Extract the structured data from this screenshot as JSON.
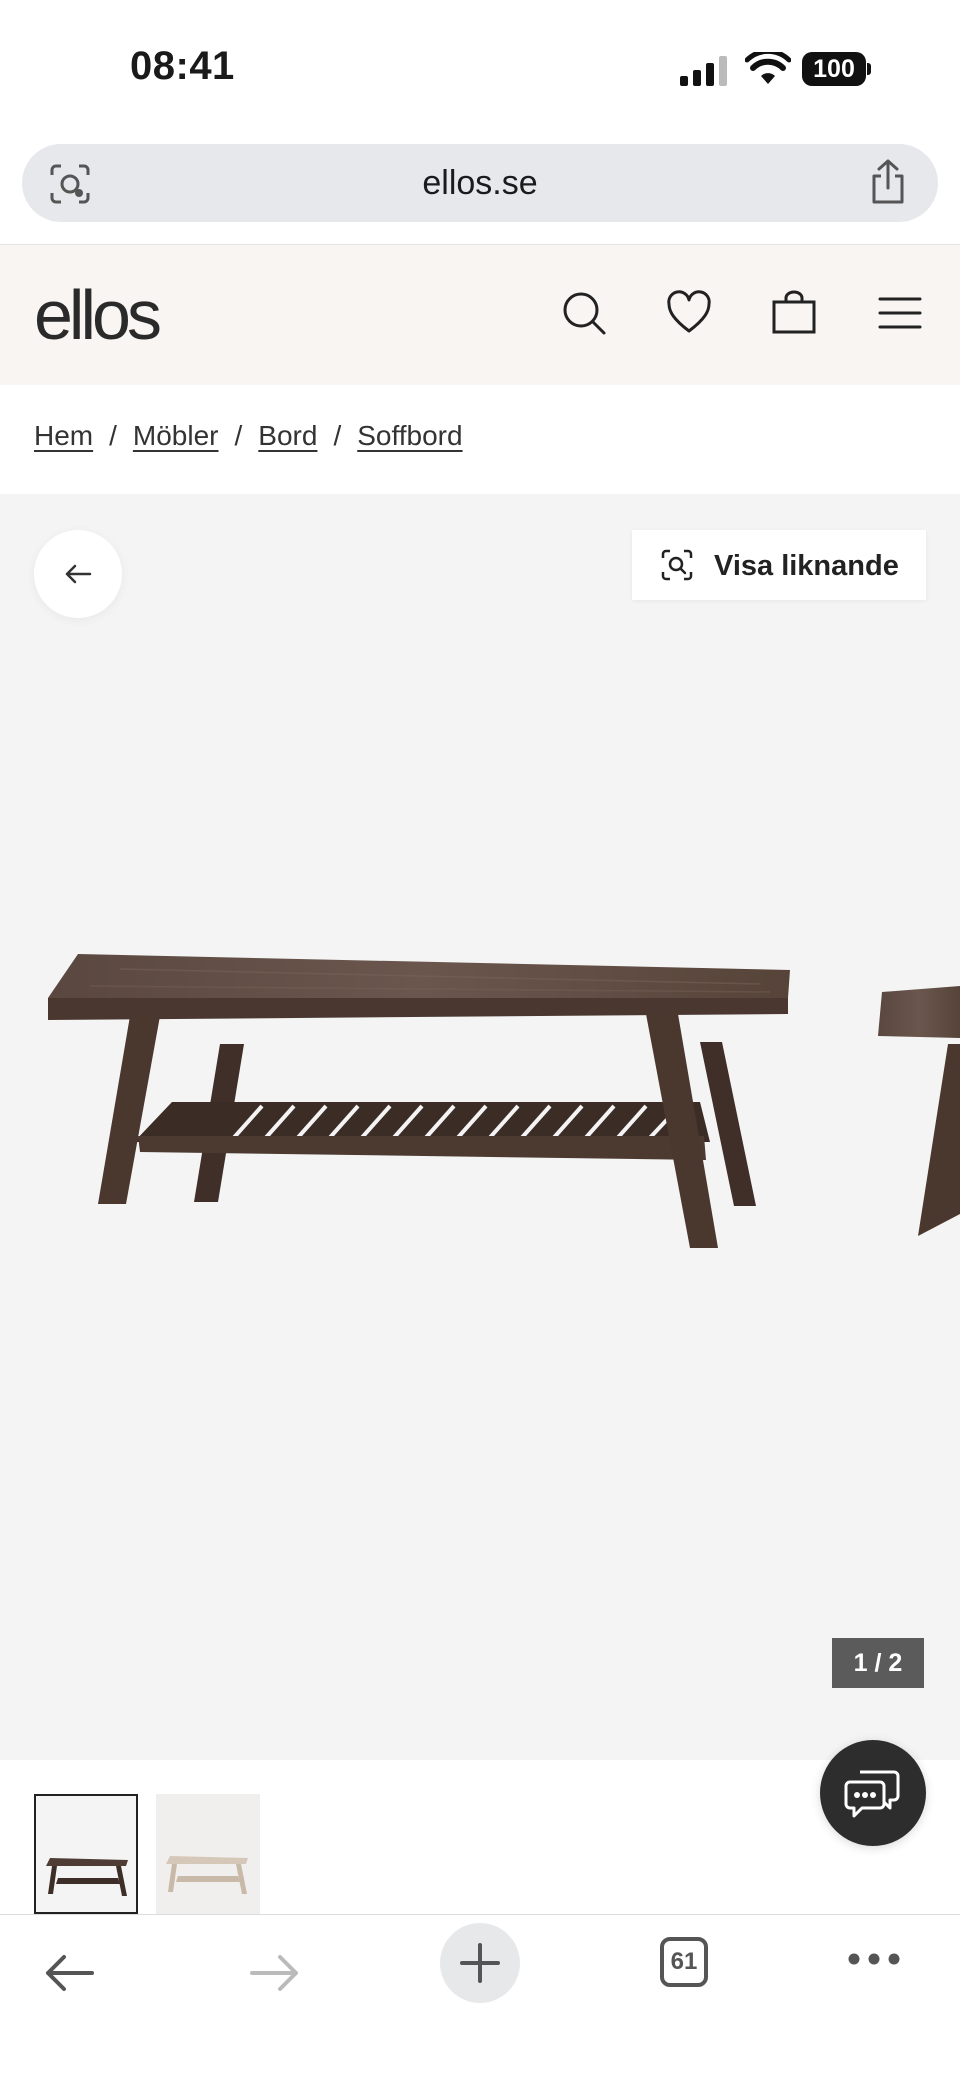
{
  "status": {
    "time": "08:41",
    "battery": "100"
  },
  "browser": {
    "url": "ellos.se",
    "tabs_count": "61"
  },
  "site": {
    "logo": "ellos"
  },
  "breadcrumb": [
    "Hem",
    "Möbler",
    "Bord",
    "Soffbord"
  ],
  "gallery": {
    "similar_label": "Visa liknande",
    "counter": "1 / 2"
  },
  "icons": {
    "lens": "visual-search-icon",
    "share": "share-icon",
    "search": "search-icon",
    "wishlist": "heart-icon",
    "cart": "bag-icon",
    "menu": "hamburger-icon",
    "back": "arrow-left-icon",
    "chat": "chat-icon"
  },
  "colors": {
    "header_bg": "#f8f5f3",
    "gallery_bg": "#f4f4f4",
    "counter_bg": "#5b5b5b",
    "chat_bg": "#2d2d2d"
  }
}
